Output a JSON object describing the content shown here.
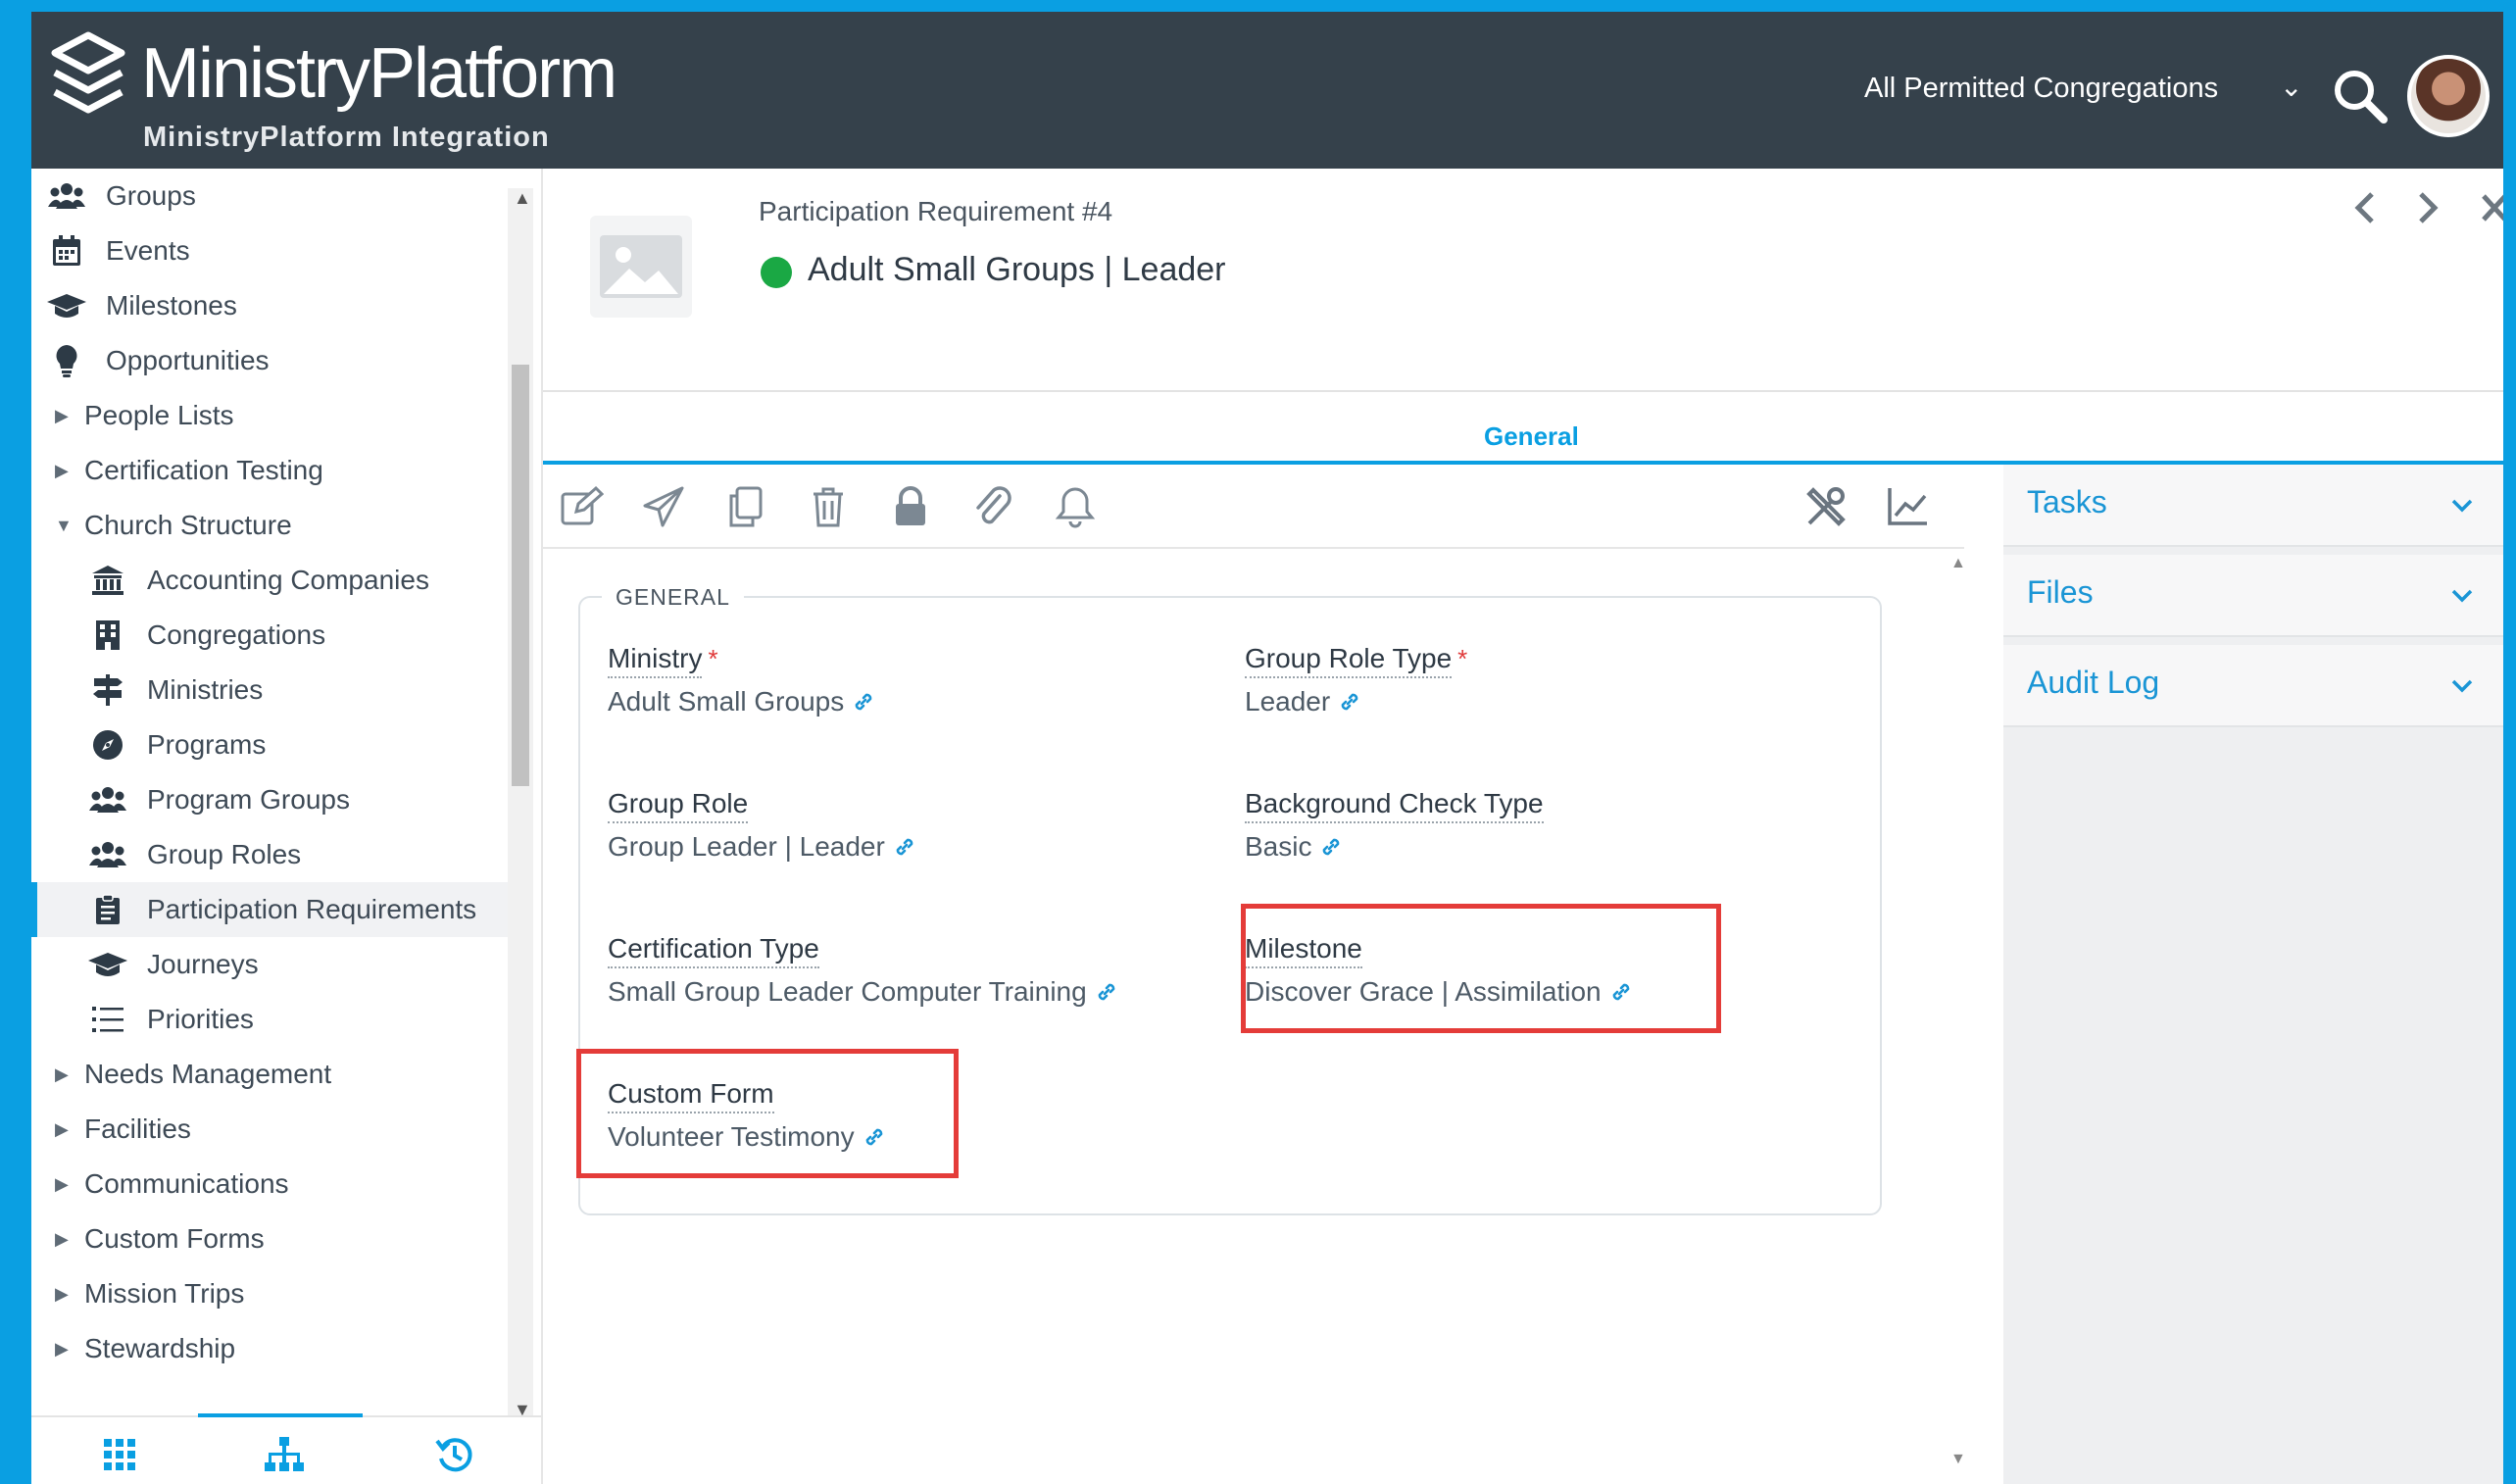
{
  "header": {
    "app_name": "MinistryPlatform",
    "app_subtitle": "MinistryPlatform Integration",
    "congregation_selector": "All Permitted Congregations"
  },
  "sidebar": {
    "top_items": [
      {
        "label": "Groups",
        "icon": "users-icon"
      },
      {
        "label": "Events",
        "icon": "calendar-icon"
      },
      {
        "label": "Milestones",
        "icon": "graduation-cap-icon"
      },
      {
        "label": "Opportunities",
        "icon": "lightbulb-icon"
      }
    ],
    "collapsed_groups_a": [
      "People Lists",
      "Certification Testing"
    ],
    "expanded_group": "Church Structure",
    "sub_items": [
      {
        "label": "Accounting Companies",
        "icon": "bank-icon"
      },
      {
        "label": "Congregations",
        "icon": "building-icon"
      },
      {
        "label": "Ministries",
        "icon": "signpost-icon"
      },
      {
        "label": "Programs",
        "icon": "compass-icon"
      },
      {
        "label": "Program Groups",
        "icon": "users-icon"
      },
      {
        "label": "Group Roles",
        "icon": "users-icon"
      },
      {
        "label": "Participation Requirements",
        "icon": "clipboard-icon"
      },
      {
        "label": "Journeys",
        "icon": "graduation-cap-icon"
      },
      {
        "label": "Priorities",
        "icon": "list-icon"
      }
    ],
    "active_item": "Participation Requirements",
    "collapsed_groups_b": [
      "Needs Management",
      "Facilities",
      "Communications",
      "Custom Forms",
      "Mission Trips",
      "Stewardship"
    ]
  },
  "record": {
    "subtitle": "Participation Requirement #4",
    "title": "Adult Small Groups | Leader",
    "status_color": "#1aa844"
  },
  "tabs": {
    "general": "General"
  },
  "form": {
    "section_label": "GENERAL",
    "ministry": {
      "label": "Ministry",
      "value": "Adult Small Groups"
    },
    "group_role_type": {
      "label": "Group Role Type",
      "value": "Leader"
    },
    "group_role": {
      "label": "Group Role",
      "value": "Group Leader | Leader"
    },
    "background_check_type": {
      "label": "Background Check Type",
      "value": "Basic"
    },
    "certification_type": {
      "label": "Certification Type",
      "value": "Small Group Leader Computer Training"
    },
    "milestone": {
      "label": "Milestone",
      "value": "Discover Grace | Assimilation"
    },
    "custom_form": {
      "label": "Custom Form",
      "value": "Volunteer Testimony"
    },
    "required_marker": "*"
  },
  "right_panel": {
    "items": [
      "Tasks",
      "Files",
      "Audit Log"
    ]
  },
  "colors": {
    "accent": "#0a9fe2",
    "header_bg": "#35414b",
    "highlight": "#e43c39"
  }
}
